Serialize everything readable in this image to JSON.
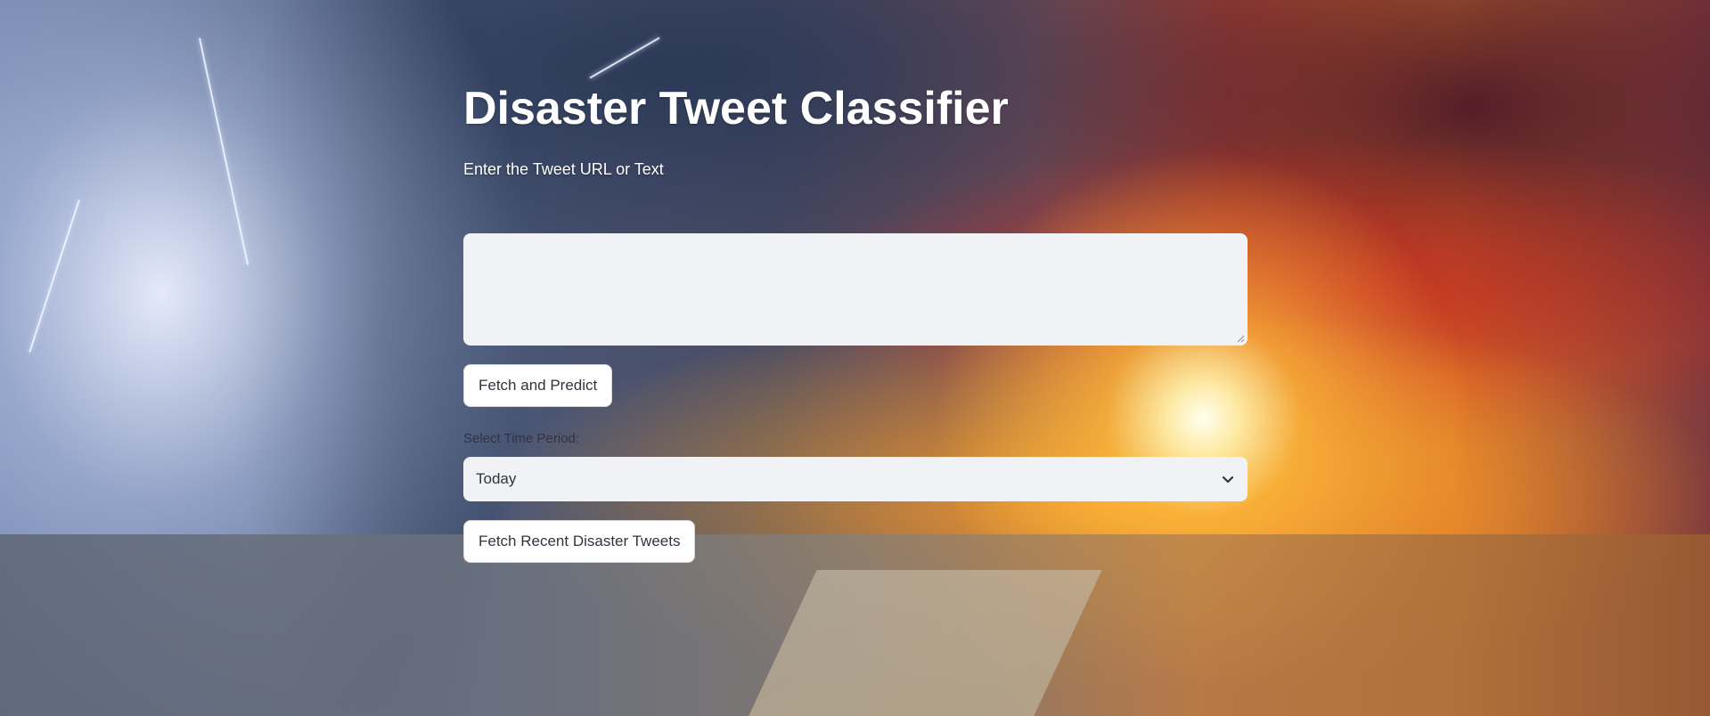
{
  "app": {
    "title": "Disaster Tweet Classifier",
    "subtitle": "Enter the Tweet URL or Text"
  },
  "tweet_input": {
    "value": "",
    "placeholder": ""
  },
  "buttons": {
    "fetch_predict": "Fetch and Predict",
    "fetch_recent": "Fetch Recent Disaster Tweets"
  },
  "time_period": {
    "label": "Select Time Period:",
    "selected": "Today"
  },
  "icons": {
    "select_arrow": "chevron-down-icon",
    "textarea_resize": "resize-handle-icon"
  },
  "colors": {
    "input_bg": "#f0f2f6",
    "text": "#31333f",
    "button_bg": "#ffffff",
    "title": "#ffffff"
  }
}
